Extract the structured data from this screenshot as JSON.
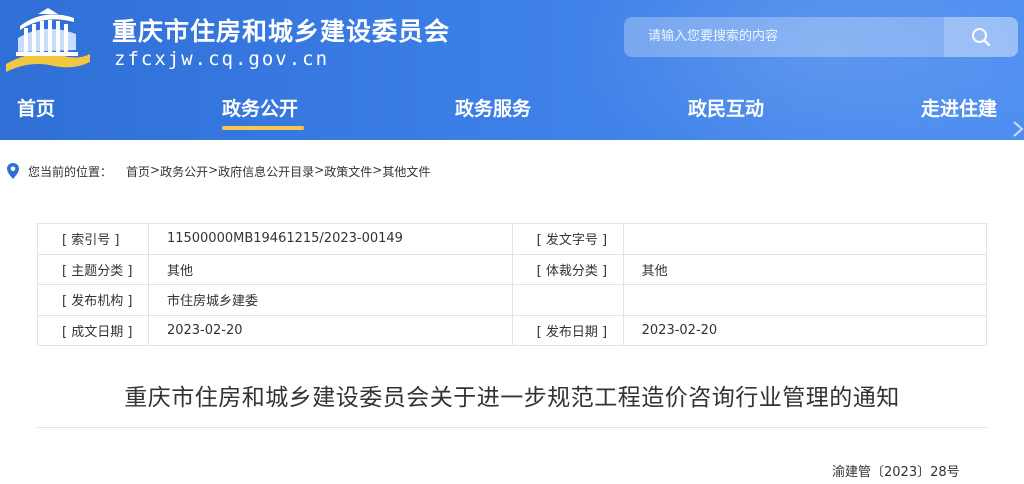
{
  "header": {
    "site_title": "重庆市住房和城乡建设委员会",
    "site_domain": "zfcxjw.cq.gov.cn",
    "search_placeholder": "请输入您要搜索的内容"
  },
  "nav": {
    "items": [
      {
        "label": "首页"
      },
      {
        "label": "政务公开"
      },
      {
        "label": "政务服务"
      },
      {
        "label": "政民互动"
      },
      {
        "label": "走进住建"
      }
    ],
    "active_index": 1
  },
  "breadcrumb": {
    "label": "您当前的位置：",
    "items": [
      "首页",
      "政务公开",
      "政府信息公开目录",
      "政策文件",
      "其他文件"
    ],
    "separator": ">"
  },
  "info_table": {
    "rows": [
      {
        "k1": "[ 索引号 ]",
        "v1": "11500000MB19461215/2023-00149",
        "k2": "[ 发文字号 ]",
        "v2": ""
      },
      {
        "k1": "[ 主题分类 ]",
        "v1": "其他",
        "k2": "[ 体裁分类 ]",
        "v2": "其他"
      },
      {
        "k1": "[ 发布机构 ]",
        "v1": "市住房城乡建委",
        "k2": "",
        "v2": ""
      },
      {
        "k1": "[ 成文日期 ]",
        "v1": "2023-02-20",
        "k2": "[ 发布日期 ]",
        "v2": "2023-02-20"
      }
    ]
  },
  "article": {
    "title": "重庆市住房和城乡建设委员会关于进一步规范工程造价咨询行业管理的通知",
    "doc_number": "渝建管〔2023〕28号"
  },
  "colors": {
    "header_bg": "#3b7ee6",
    "nav_underline": "#f6c94a",
    "location_pin": "#2f6fd6"
  },
  "icons": {
    "emblem": "government-building-logo",
    "search": "search-icon",
    "location": "location-pin-icon"
  }
}
